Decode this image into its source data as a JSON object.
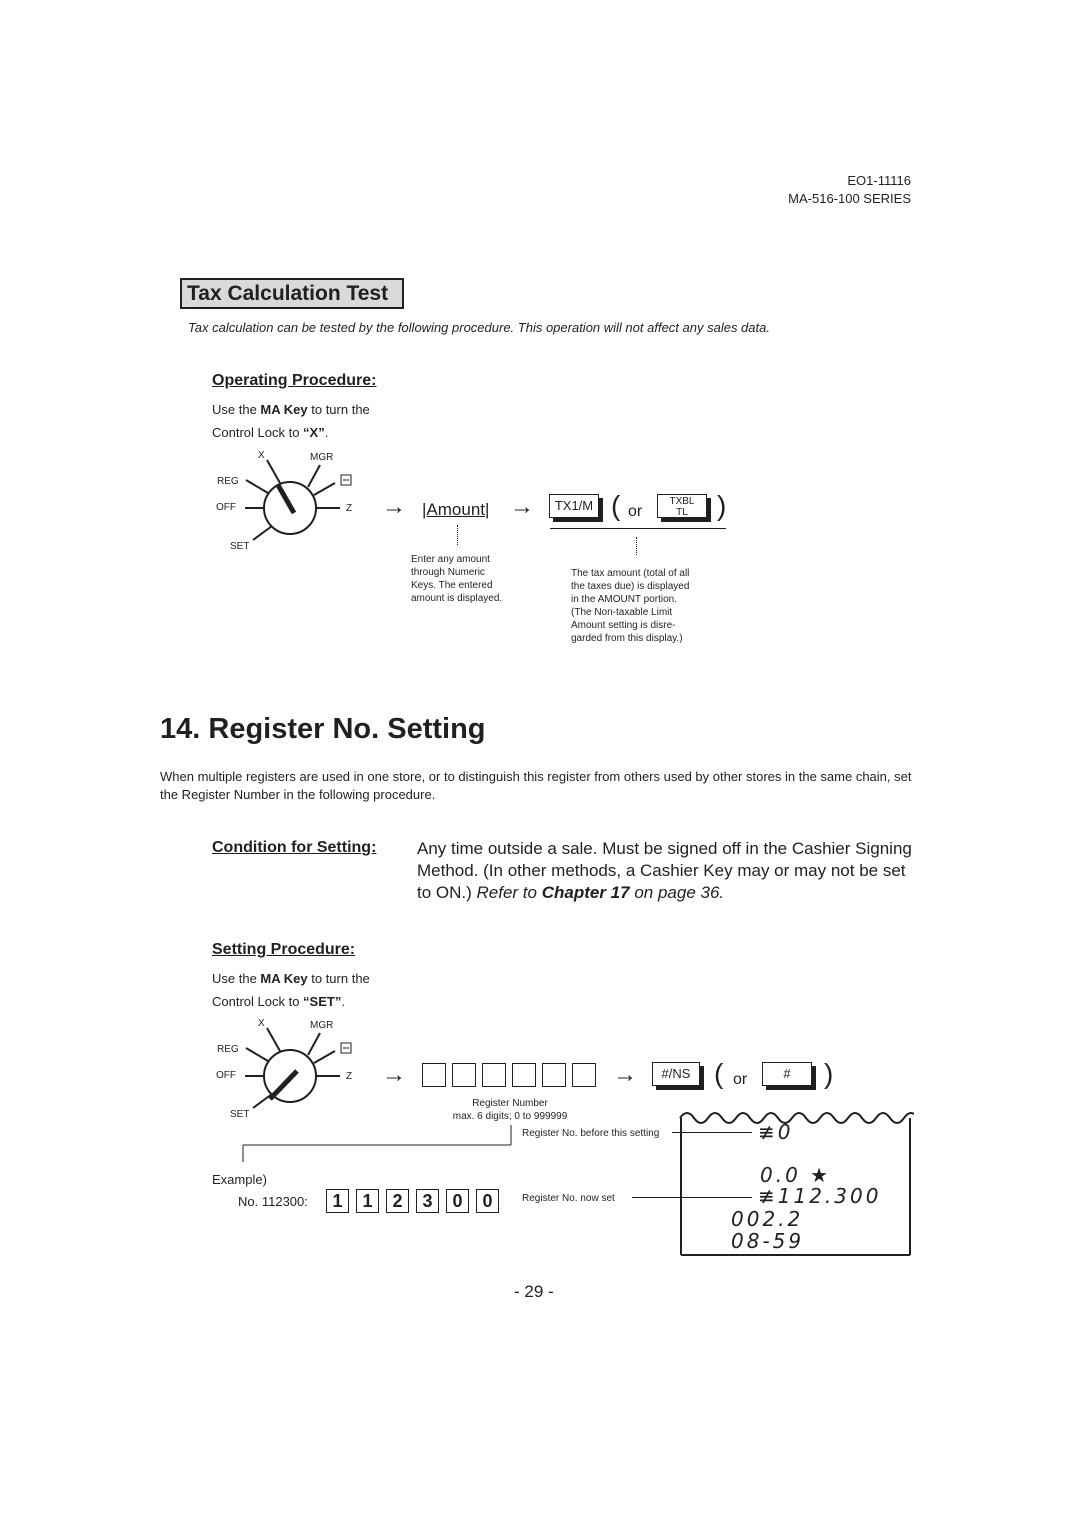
{
  "header": {
    "doc_number": "EO1-11116",
    "series": "MA-516-100 SERIES"
  },
  "tax_test": {
    "title": "Tax Calculation Test",
    "intro": "Tax calculation can be tested by the following procedure. This operation will not affect any sales data.",
    "operating_heading": "Operating Procedure:",
    "instruction_pre": "Use the ",
    "instruction_key": "MA Key",
    "instruction_mid": " to turn the",
    "instruction_line2_pre": "Control Lock to ",
    "instruction_position": "“X”",
    "instruction_end": ".",
    "lock_labels": {
      "x": "X",
      "mgr": "MGR",
      "reg": "REG",
      "minus": "-",
      "off": "OFF",
      "z": "Z",
      "set": "SET"
    },
    "lock_position": "X",
    "amount_label": "|Amount|",
    "key_tx1m": "TX1/M",
    "or": "or",
    "key_txbl_line1": "TXBL",
    "key_txbl_line2": "TL",
    "note_amount": [
      "Enter any amount",
      "through Numeric",
      "Keys. The entered",
      "amount is displayed."
    ],
    "note_tax": [
      "The tax amount (total of all",
      "the taxes due) is displayed",
      "in the AMOUNT portion.",
      "(The Non-taxable Limit",
      "Amount setting is disre-",
      "garded from this display.)"
    ]
  },
  "register_setting": {
    "heading": "14. Register No. Setting",
    "description": "When multiple registers are used in one store, or to distinguish this register from others used by other stores in the same chain, set the Register Number in the following procedure.",
    "condition_label": "Condition for Setting:",
    "condition_text": "Any time outside a sale. Must be signed off in the Cashier Signing Method. (In other methods, a Cashier Key may or may not be set to ON.) ",
    "condition_ref_pre": "Refer to ",
    "condition_ref_chapter": "Chapter 17",
    "condition_ref_post": " on page 36.",
    "setting_heading": "Setting Procedure:",
    "instruction_pre": "Use the ",
    "instruction_key": "MA Key",
    "instruction_mid": " to turn the",
    "instruction_line2_pre": "Control Lock to ",
    "instruction_position": "“SET”",
    "instruction_end": ".",
    "lock_position": "SET",
    "register_number_label": "Register Number",
    "register_number_range": "max. 6 digits; 0 to 999999",
    "key_ns": "#/NS",
    "or": "or",
    "key_hash": "#",
    "example_label": "Example)",
    "example_number_label": "No. 112300:",
    "example_digits": [
      "1",
      "1",
      "2",
      "3",
      "0",
      "0"
    ],
    "before_label": "Register No. before this setting",
    "now_label": "Register No. now set",
    "receipt": {
      "before": "≢0",
      "line1": "0.0 ★",
      "line2": "≢112.300",
      "line3": "002.2",
      "line4": "08-59"
    }
  },
  "footer": {
    "page": "- 29 -"
  }
}
